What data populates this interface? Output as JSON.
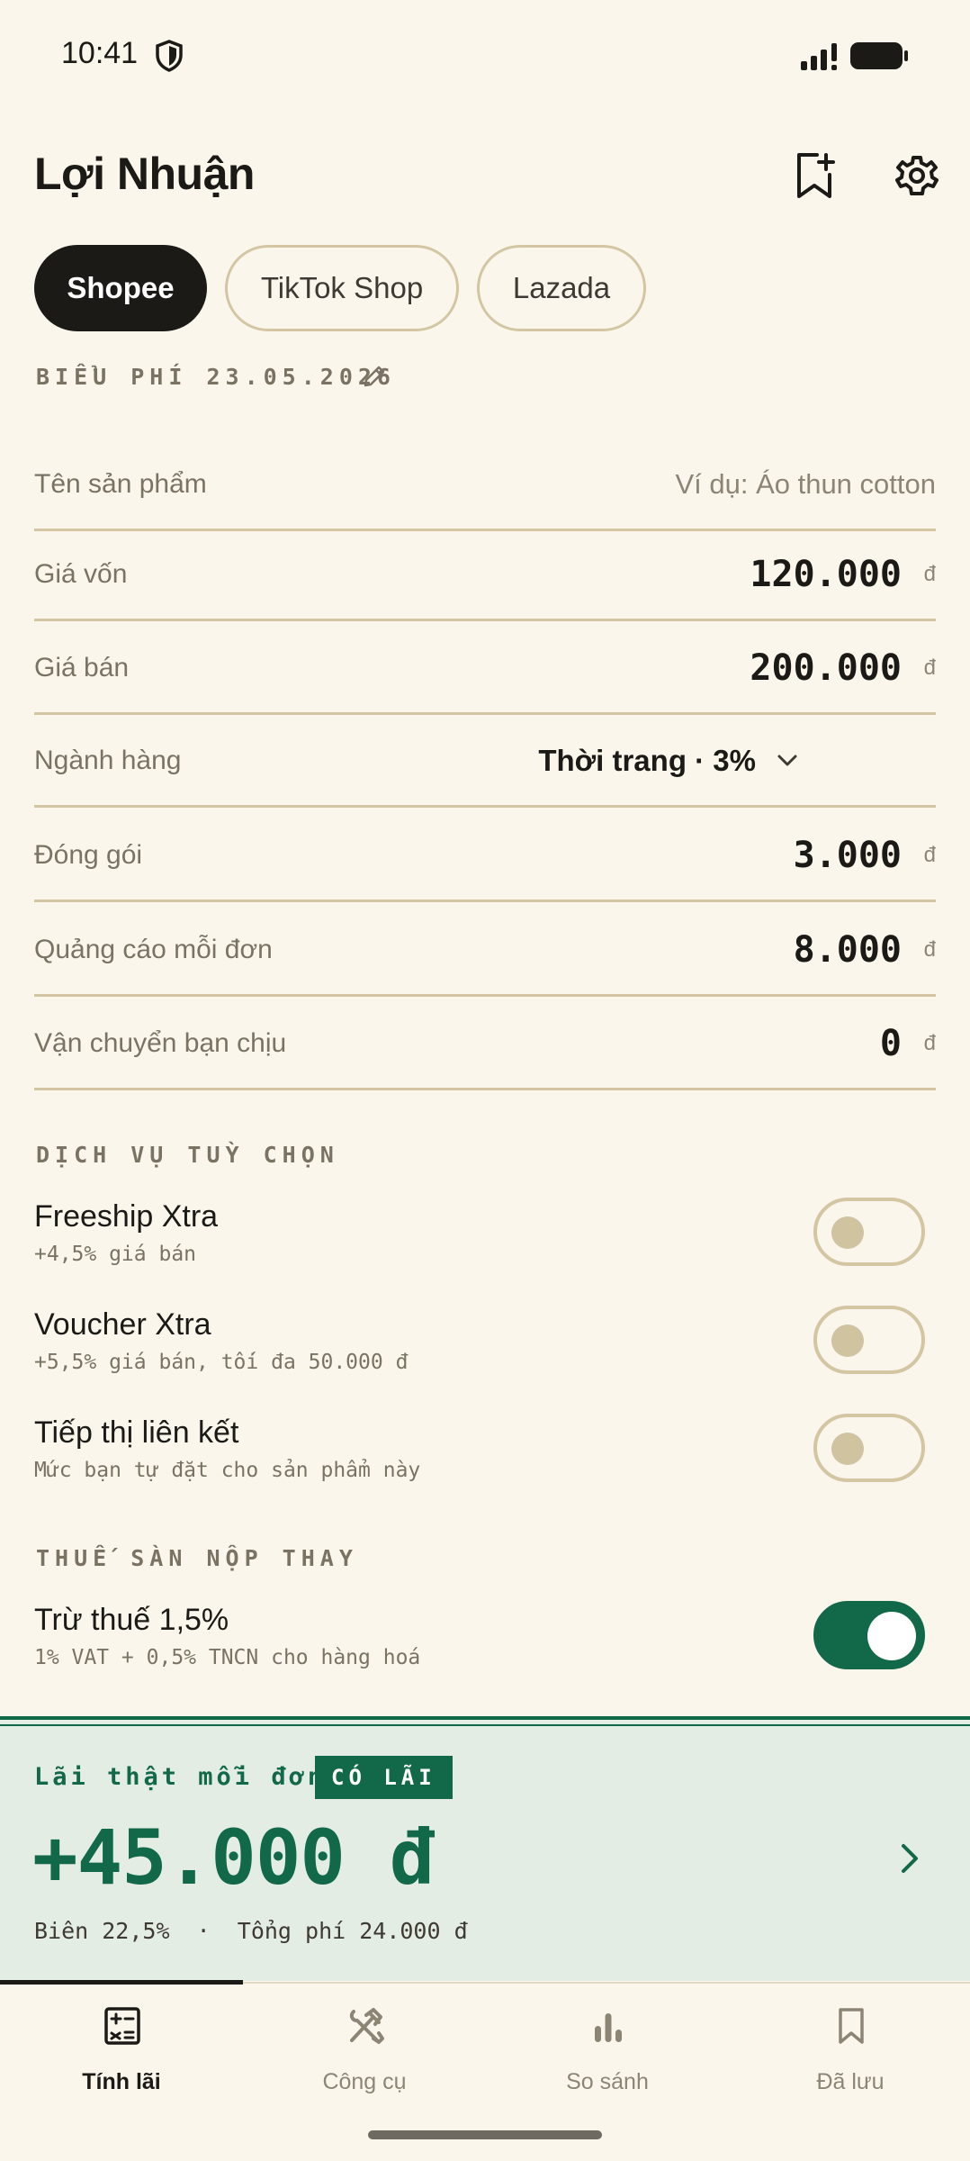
{
  "status": {
    "time": "10:41"
  },
  "header": {
    "title": "Lợi Nhuận"
  },
  "platforms": [
    "Shopee",
    "TikTok Shop",
    "Lazada"
  ],
  "active_platform": "Shopee",
  "fee_schedule": "BIỂU PHÍ 23.05.2026",
  "form": {
    "product_name": {
      "label": "Tên sản phẩm",
      "placeholder": "Ví dụ: Áo thun cotton"
    },
    "cost": {
      "label": "Giá vốn",
      "value": "120.000",
      "unit": "đ"
    },
    "price": {
      "label": "Giá bán",
      "value": "200.000",
      "unit": "đ"
    },
    "category": {
      "label": "Ngành hàng",
      "value": "Thời trang · 3%"
    },
    "packaging": {
      "label": "Đóng gói",
      "value": "3.000",
      "unit": "đ"
    },
    "ads": {
      "label": "Quảng cáo mỗi đơn",
      "value": "8.000",
      "unit": "đ"
    },
    "shipping": {
      "label": "Vận chuyển bạn chịu",
      "value": "0",
      "unit": "đ"
    }
  },
  "optional_services": {
    "label": "DỊCH VỤ TUỲ CHỌN",
    "items": [
      {
        "title": "Freeship Xtra",
        "subtitle": "+4,5% giá bán",
        "enabled": false
      },
      {
        "title": "Voucher Xtra",
        "subtitle": "+5,5% giá bán, tối đa 50.000 đ",
        "enabled": false
      },
      {
        "title": "Tiếp thị liên kết",
        "subtitle": "Mức bạn tự đặt cho sản phẩm này",
        "enabled": false
      }
    ]
  },
  "tax": {
    "label": "THUẾ SÀN NỘP THAY",
    "title": "Trừ thuế 1,5%",
    "subtitle": "1% VAT + 0,5% TNCN cho hàng hoá",
    "enabled": true
  },
  "result": {
    "label": "Lãi thật mỗi đơn",
    "badge": "CÓ LÃI",
    "amount": "+45.000 đ",
    "meta": "Biên 22,5%  ·  Tổng phí 24.000 đ"
  },
  "nav": [
    {
      "label": "Tính lãi",
      "icon": "calculator-icon",
      "active": true
    },
    {
      "label": "Công cụ",
      "icon": "tools-icon",
      "active": false
    },
    {
      "label": "So sánh",
      "icon": "bar-chart-icon",
      "active": false
    },
    {
      "label": "Đã lưu",
      "icon": "bookmark-icon",
      "active": false
    }
  ],
  "colors": {
    "background": "#FAF6EC",
    "accent": "#12694A",
    "ink": "#1C1A16",
    "border": "#D4C6A3"
  }
}
